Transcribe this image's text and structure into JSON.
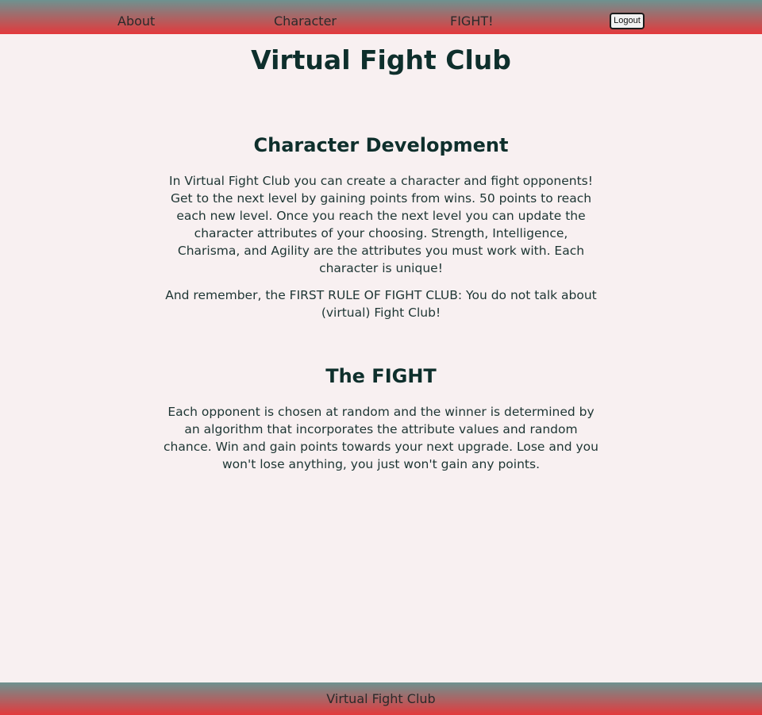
{
  "nav": {
    "about": "About",
    "character": "Character",
    "fight": "FIGHT!",
    "logout": "Logout"
  },
  "page": {
    "title": "Virtual Fight Club"
  },
  "development": {
    "heading": "Character Development",
    "paragraph1": "In Virtual Fight Club you can create a character and fight opponents! Get to the next level by gaining points from wins. 50 points to reach each new level. Once you reach the next level you can update the character attributes of your choosing. Strength, Intelligence, Charisma, and Agility are the attributes you must work with. Each character is unique!",
    "paragraph2": "And remember, the FIRST RULE OF FIGHT CLUB: You do not talk about (virtual) Fight Club!"
  },
  "fight": {
    "heading": "The FIGHT",
    "paragraph": "Each opponent is chosen at random and the winner is determined by an algorithm that incorporates the attribute values and random chance. Win and gain points towards your next upgrade. Lose and you won't lose anything, you just won't gain any points."
  },
  "footer": {
    "text": "Virtual Fight Club"
  },
  "colors": {
    "background": "#f8f0f1",
    "gradient_top": "#6e9290",
    "gradient_bottom": "#e4393c",
    "text_dark": "#0e2f2c"
  }
}
